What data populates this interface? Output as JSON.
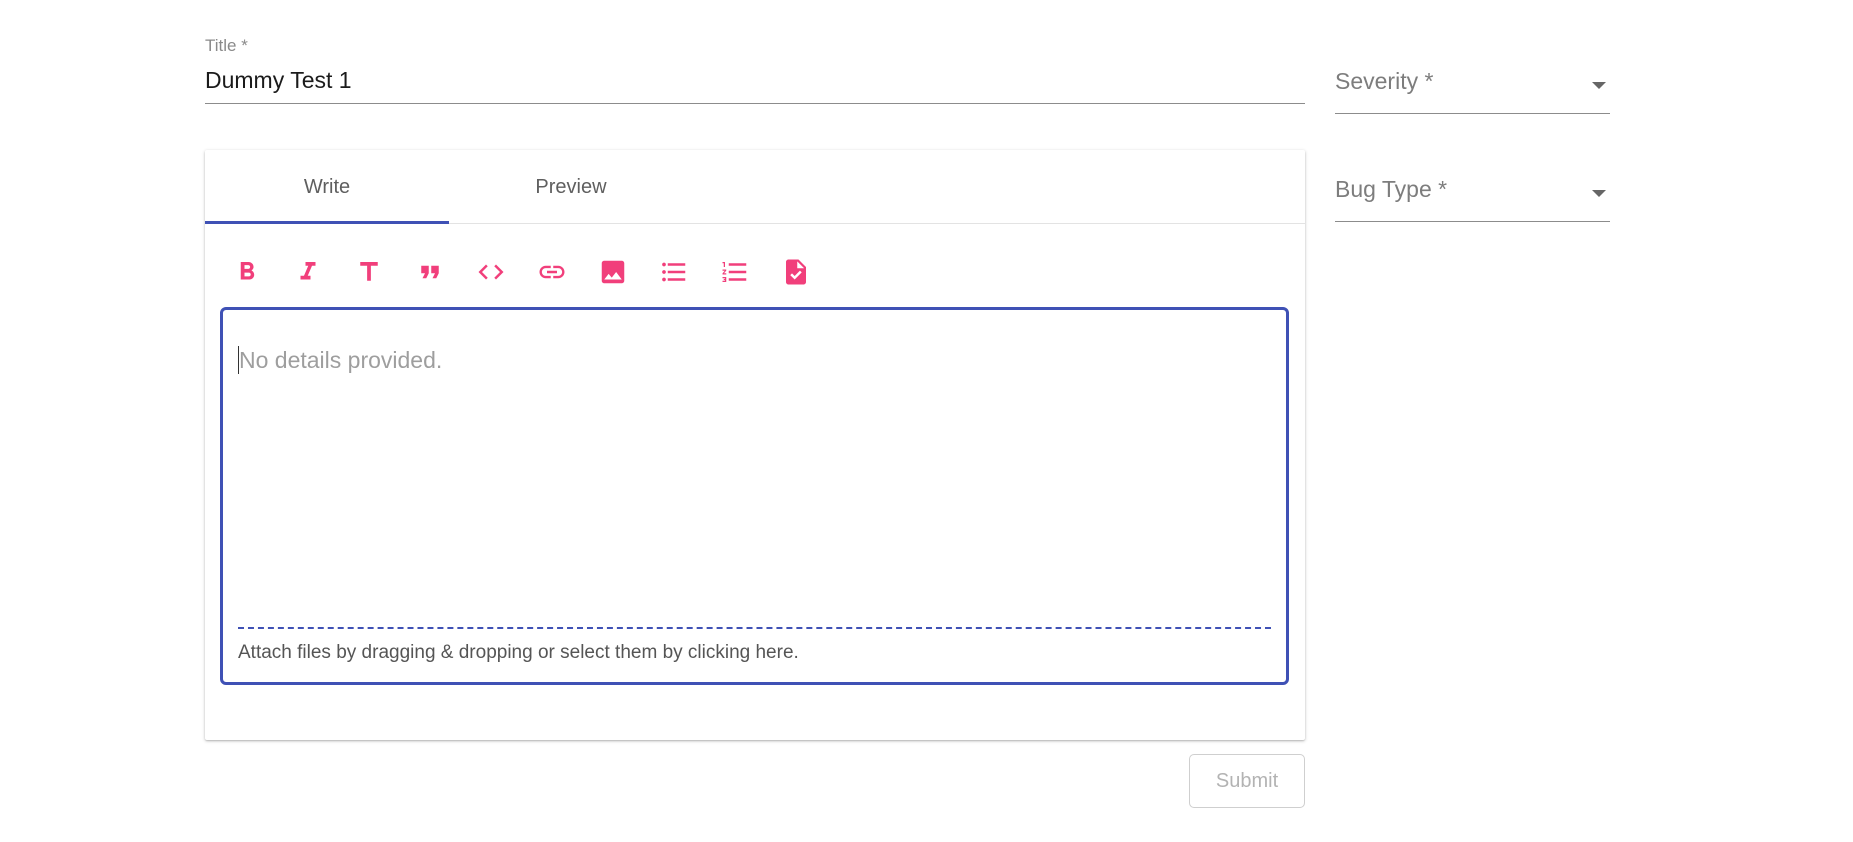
{
  "form": {
    "title_label": "Title *",
    "title_value": "Dummy Test 1",
    "severity_label": "Severity *",
    "bug_type_label": "Bug Type *",
    "submit_label": "Submit"
  },
  "editor": {
    "tabs": [
      {
        "label": "Write",
        "active": true
      },
      {
        "label": "Preview",
        "active": false
      }
    ],
    "toolbar": [
      {
        "name": "bold-icon"
      },
      {
        "name": "italic-icon"
      },
      {
        "name": "heading-icon"
      },
      {
        "name": "quote-icon"
      },
      {
        "name": "code-icon"
      },
      {
        "name": "link-icon"
      },
      {
        "name": "image-icon"
      },
      {
        "name": "bulleted-list-icon"
      },
      {
        "name": "numbered-list-icon"
      },
      {
        "name": "checklist-icon"
      }
    ],
    "placeholder": "No details provided.",
    "attach_text": "Attach files by dragging & dropping or select them by clicking here."
  },
  "colors": {
    "primary": "#3f51b5",
    "toolbar_icon": "#f13f7b",
    "muted_text": "#9e9e9e"
  }
}
